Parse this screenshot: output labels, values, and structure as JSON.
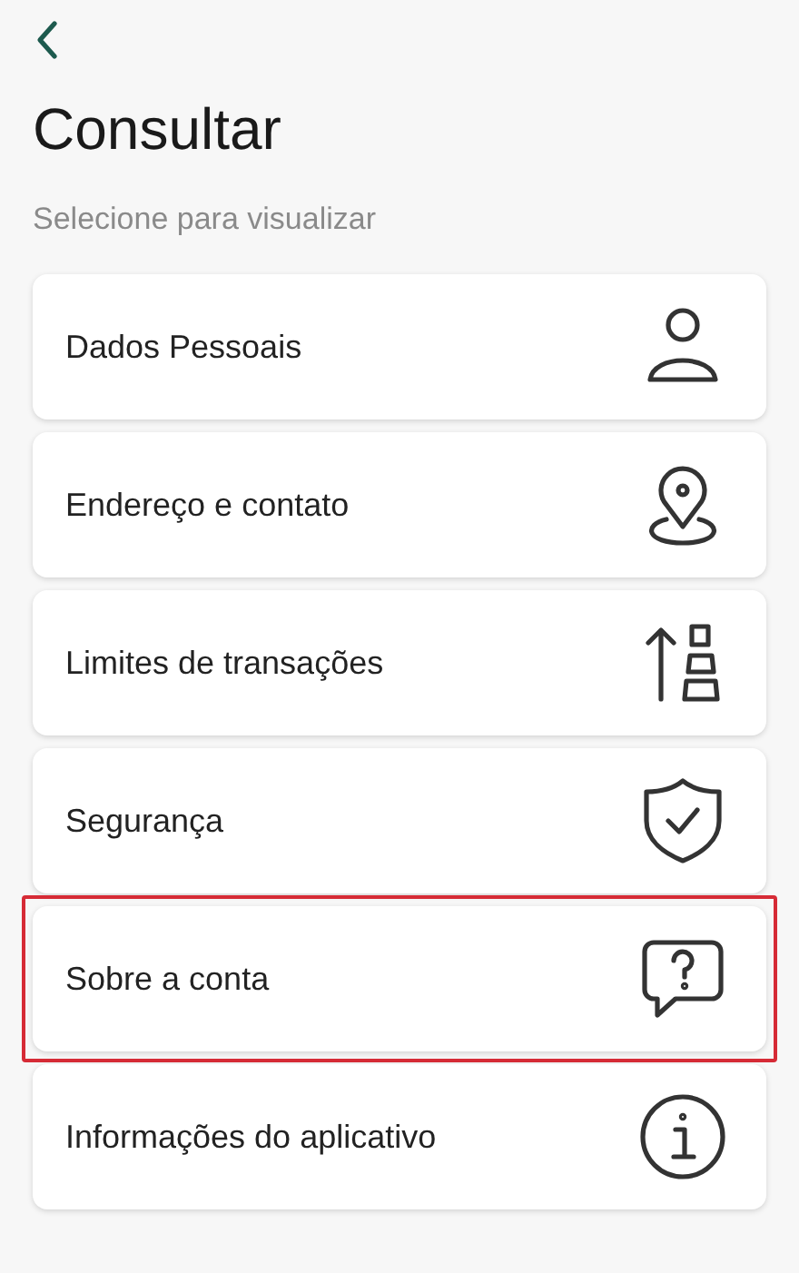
{
  "header": {
    "title": "Consultar",
    "subtitle": "Selecione para visualizar"
  },
  "items": [
    {
      "label": "Dados Pessoais",
      "kind": "person",
      "highlighted": false
    },
    {
      "label": "Endereço e contato",
      "kind": "location",
      "highlighted": false
    },
    {
      "label": "Limites de transações",
      "kind": "limits",
      "highlighted": false
    },
    {
      "label": "Segurança",
      "kind": "shield",
      "highlighted": false
    },
    {
      "label": "Sobre a conta",
      "kind": "question",
      "highlighted": true
    },
    {
      "label": "Informações do aplicativo",
      "kind": "info",
      "highlighted": false
    }
  ]
}
